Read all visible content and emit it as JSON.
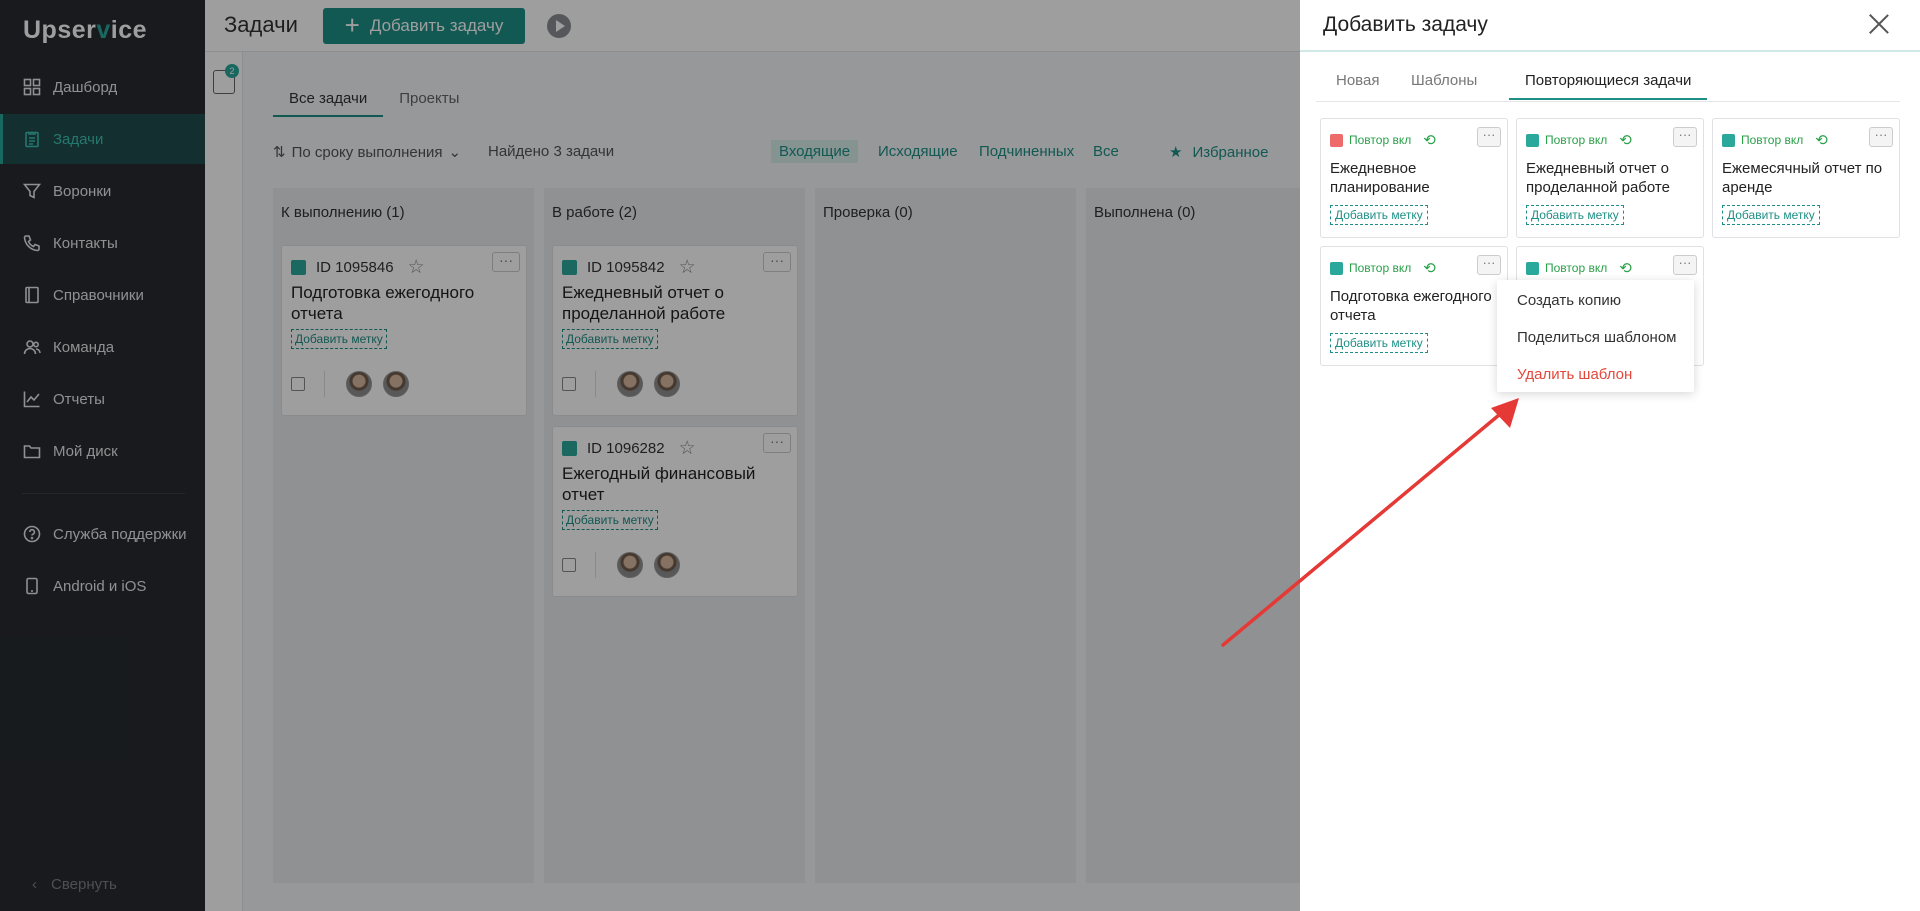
{
  "app": {
    "logo_main": "Upser",
    "logo_accent": "v",
    "logo_tail": "ice"
  },
  "sidebar": {
    "items": [
      {
        "label": "Дашборд",
        "icon": "dashboard-icon"
      },
      {
        "label": "Задачи",
        "icon": "tasks-icon",
        "active": true
      },
      {
        "label": "Воронки",
        "icon": "funnel-icon"
      },
      {
        "label": "Контакты",
        "icon": "phone-icon"
      },
      {
        "label": "Справочники",
        "icon": "book-icon"
      },
      {
        "label": "Команда",
        "icon": "team-icon"
      },
      {
        "label": "Отчеты",
        "icon": "chart-icon"
      },
      {
        "label": "Мой диск",
        "icon": "folder-icon"
      }
    ],
    "bottom_items": [
      {
        "label": "Служба поддержки",
        "icon": "help-icon"
      },
      {
        "label": "Android и iOS",
        "icon": "mobile-icon"
      }
    ],
    "collapse_label": "Свернуть"
  },
  "header": {
    "title": "Задачи",
    "add_button": "Добавить задачу"
  },
  "filters": {
    "badge": "2"
  },
  "main_tabs": [
    "Все задачи",
    "Проекты"
  ],
  "toolbar": {
    "sort_label": "По сроку выполнения",
    "found": "Найдено 3 задачи",
    "filter_buttons": [
      "Входящие",
      "Исходящие",
      "Подчиненных",
      "Все"
    ],
    "favorites": "Избранное"
  },
  "columns": [
    {
      "title": "К выполнению (1)"
    },
    {
      "title": "В работе (2)"
    },
    {
      "title": "Проверка (0)"
    },
    {
      "title": "Выполнена (0)"
    }
  ],
  "cards": [
    {
      "id": "ID 1095846",
      "title": "Подготовка ежегодного отчета",
      "tag": "Добавить метку"
    },
    {
      "id": "ID 1095842",
      "title": "Ежедневный отчет о проделанной работе",
      "tag": "Добавить метку"
    },
    {
      "id": "ID 1096282",
      "title": "Ежегодный финансовый отчет",
      "tag": "Добавить метку"
    }
  ],
  "panel": {
    "title": "Добавить задачу",
    "tabs": [
      "Новая",
      "Шаблоны",
      "Повторяющиеся задачи"
    ],
    "templates": [
      {
        "status": "Повтор вкл",
        "title": "Ежедневное планирование",
        "tag": "Добавить метку",
        "icon_color": "#ef6b6b"
      },
      {
        "status": "Повтор вкл",
        "title": "Ежедневный отчет о проделанной работе",
        "tag": "Добавить метку",
        "icon_color": "#2aa89b"
      },
      {
        "status": "Повтор вкл",
        "title": "Ежемесячный отчет по аренде",
        "tag": "Добавить метку",
        "icon_color": "#2aa89b"
      },
      {
        "status": "Повтор вкл",
        "title": "Подготовка ежегодного отчета",
        "tag": "Добавить метку",
        "icon_color": "#2aa89b"
      },
      {
        "status": "Повтор вкл",
        "title": "",
        "tag": "",
        "icon_color": "#2aa89b"
      }
    ],
    "context_menu": [
      "Создать копию",
      "Поделиться шаблоном",
      "Удалить шаблон"
    ]
  },
  "colors": {
    "accent": "#1e8f86",
    "danger": "#e5473c",
    "sidebar_bg": "#272b30"
  }
}
